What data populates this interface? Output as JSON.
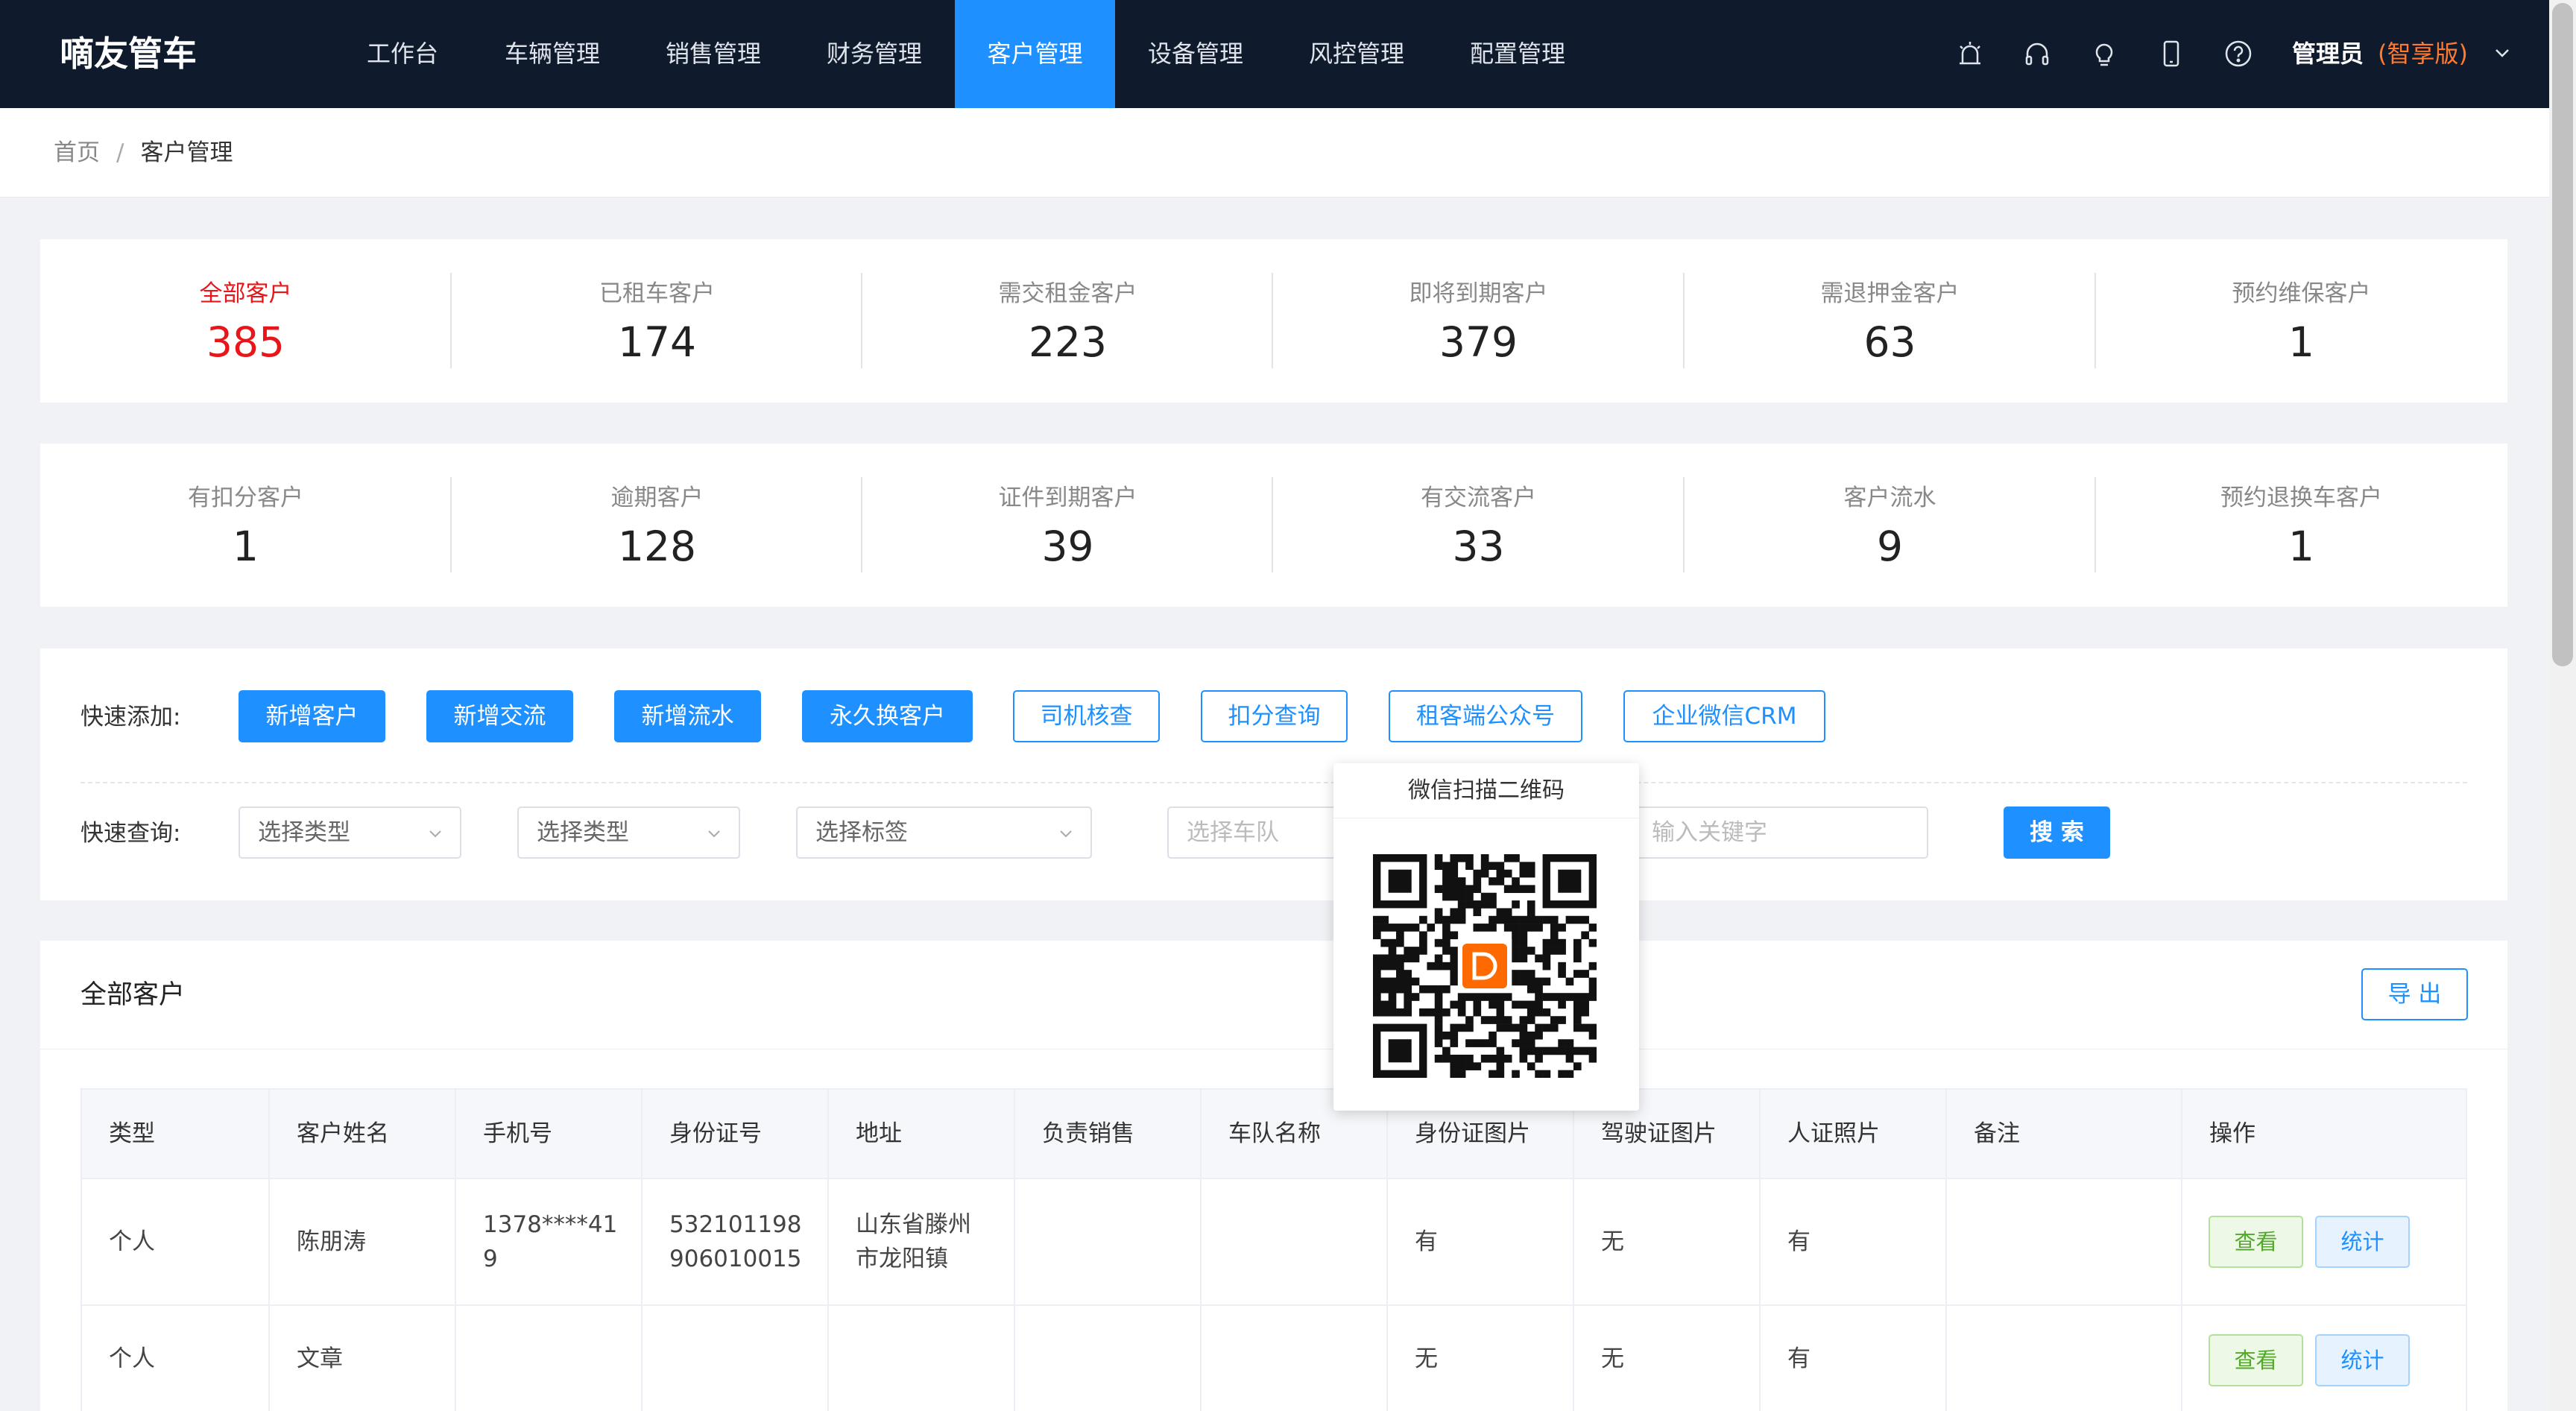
{
  "header": {
    "logo": "嘀友管车",
    "nav": [
      {
        "label": "工作台",
        "active": false
      },
      {
        "label": "车辆管理",
        "active": false
      },
      {
        "label": "销售管理",
        "active": false
      },
      {
        "label": "财务管理",
        "active": false
      },
      {
        "label": "客户管理",
        "active": true
      },
      {
        "label": "设备管理",
        "active": false
      },
      {
        "label": "风控管理",
        "active": false
      },
      {
        "label": "配置管理",
        "active": false
      }
    ],
    "icons": [
      "alarm-icon",
      "headset-icon",
      "bulb-icon",
      "phone-icon",
      "help-icon"
    ],
    "user": "管理员",
    "edition": "(智享版)"
  },
  "breadcrumb": {
    "home": "首页",
    "separator": "/",
    "current": "客户管理"
  },
  "stats_row1": [
    {
      "label": "全部客户",
      "value": "385",
      "highlight": true
    },
    {
      "label": "已租车客户",
      "value": "174"
    },
    {
      "label": "需交租金客户",
      "value": "223"
    },
    {
      "label": "即将到期客户",
      "value": "379"
    },
    {
      "label": "需退押金客户",
      "value": "63"
    },
    {
      "label": "预约维保客户",
      "value": "1"
    }
  ],
  "stats_row2": [
    {
      "label": "有扣分客户",
      "value": "1"
    },
    {
      "label": "逾期客户",
      "value": "128"
    },
    {
      "label": "证件到期客户",
      "value": "39"
    },
    {
      "label": "有交流客户",
      "value": "33"
    },
    {
      "label": "客户流水",
      "value": "9"
    },
    {
      "label": "预约退换车客户",
      "value": "1"
    }
  ],
  "quick_add": {
    "label": "快速添加:",
    "solid_buttons": [
      "新增客户",
      "新增交流",
      "新增流水",
      "永久换客户"
    ],
    "outline_buttons": [
      "司机核查",
      "扣分查询",
      "租客端公众号",
      "企业微信CRM"
    ]
  },
  "quick_search": {
    "label": "快速查询:",
    "selects": [
      "选择类型",
      "选择类型",
      "选择标签"
    ],
    "team_placeholder": "选择车队",
    "keyword_placeholder": "输入关键字",
    "search_button": "搜 索"
  },
  "qr_popup": {
    "title": "微信扫描二维码"
  },
  "table": {
    "title": "全部客户",
    "export_button": "导 出",
    "columns": [
      "类型",
      "客户姓名",
      "手机号",
      "身份证号",
      "地址",
      "负责销售",
      "车队名称",
      "身份证图片",
      "驾驶证图片",
      "人证照片",
      "备注",
      "操作"
    ],
    "rows": [
      {
        "cells": [
          "个人",
          "陈朋涛",
          "1378****419",
          "532101198906010015",
          "山东省滕州市龙阳镇",
          "",
          "",
          "有",
          "无",
          "有",
          ""
        ]
      },
      {
        "cells": [
          "个人",
          "文章",
          "",
          "",
          "",
          "",
          "",
          "无",
          "无",
          "有",
          ""
        ]
      }
    ],
    "view_label": "查看",
    "stat_label": "统计"
  },
  "colors": {
    "header_bg": "#0f1b2d",
    "accent": "#1e90ff",
    "highlight_red": "#e8161a",
    "edition_orange": "#ff7a2e"
  }
}
